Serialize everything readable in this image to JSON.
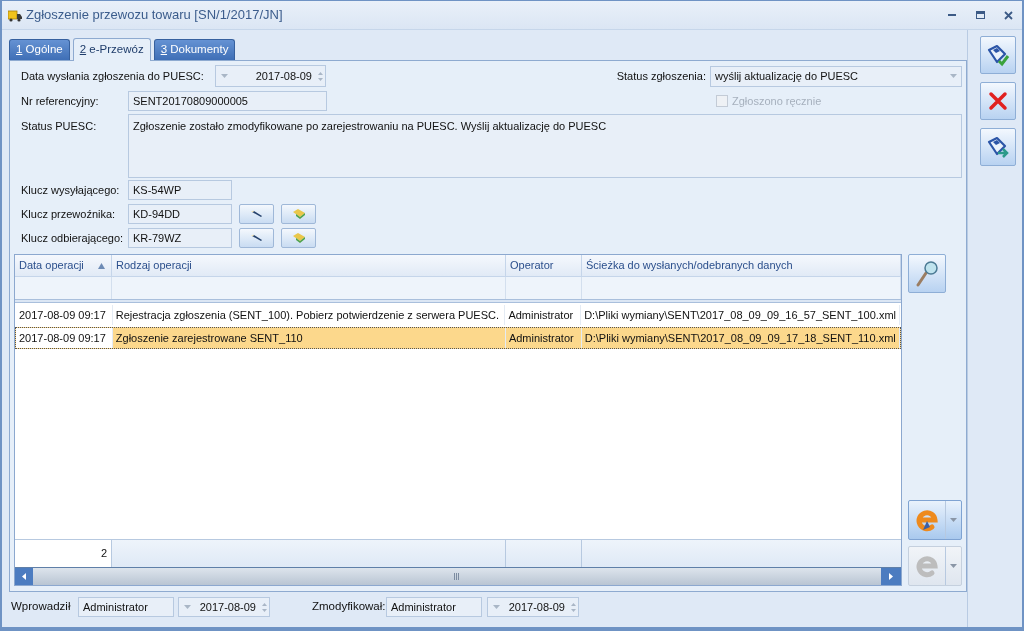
{
  "window": {
    "title": "Zgłoszenie przewozu towaru [SN/1/2017/JN]"
  },
  "tabs": [
    {
      "hotkey": "1",
      "label": "Ogólne",
      "selected": false
    },
    {
      "hotkey": "2",
      "label": "e-Przewóz",
      "selected": true
    },
    {
      "hotkey": "3",
      "label": "Dokumenty",
      "selected": false
    }
  ],
  "form": {
    "send_date": {
      "label": "Data wysłania zgłoszenia do PUESC:",
      "value": "2017-08-09"
    },
    "declaration_status": {
      "label": "Status zgłoszenia:",
      "value": "wyślij aktualizację do PUESC"
    },
    "reported_manually": {
      "label": "Zgłoszono ręcznie",
      "checked": false,
      "disabled": true
    },
    "reference_number": {
      "label": "Nr referencyjny:",
      "value": "SENT20170809000005"
    },
    "puesc_status": {
      "label": "Status PUESC:",
      "value": "Zgłoszenie zostało zmodyfikowane po zarejestrowaniu na PUESC. Wyślij aktualizację do PUESC"
    },
    "keys": [
      {
        "kind": "plain",
        "label": "Klucz wysyłającego:",
        "value": "KS-54WP"
      },
      {
        "kind": "editable",
        "label": "Klucz przewoźnika:",
        "value": "KD-94DD"
      },
      {
        "kind": "editable",
        "label": "Klucz odbierającego:",
        "value": "KR-79WZ"
      }
    ]
  },
  "table": {
    "columns": [
      {
        "label": "Data operacji",
        "sorted": true
      },
      {
        "label": "Rodzaj operacji",
        "sorted": false
      },
      {
        "label": "Operator",
        "sorted": false
      },
      {
        "label": "Ścieżka do wysłanych/odebranych danych",
        "sorted": false
      }
    ],
    "rows": [
      {
        "selected": false,
        "cells": [
          "2017-08-09 09:17",
          "Rejestracja zgłoszenia (SENT_100). Pobierz potwierdzenie z serwera PUESC.",
          "Administrator",
          "D:\\Pliki wymiany\\SENT\\2017_08_09_09_16_57_SENT_100.xml"
        ]
      },
      {
        "selected": true,
        "cells": [
          "2017-08-09 09:17",
          "Zgłoszenie zarejestrowane SENT_110",
          "Administrator",
          "D:\\Pliki wymiany\\SENT\\2017_08_09_09_17_18_SENT_110.xml"
        ]
      }
    ],
    "row_count": "2"
  },
  "side_actions": [
    {
      "disabled": false
    },
    {
      "disabled": true
    }
  ],
  "footer": {
    "created": {
      "label": "Wprowadził",
      "user": "Administrator",
      "date": "2017-08-09"
    },
    "modified": {
      "label": "Zmodyfikował:",
      "user": "Administrator",
      "date": "2017-08-09"
    }
  }
}
